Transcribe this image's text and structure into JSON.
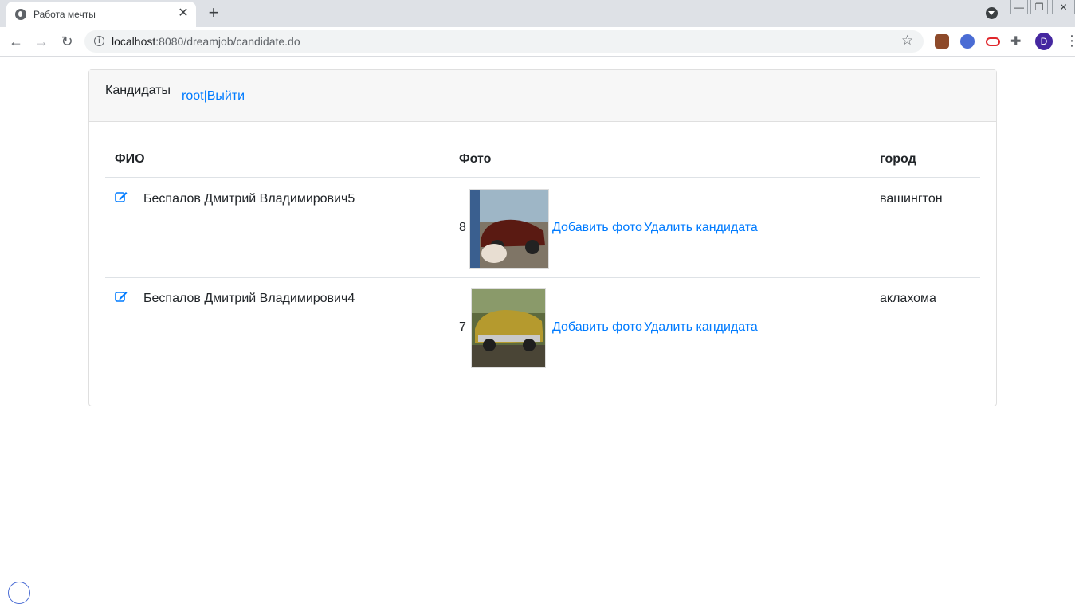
{
  "browser": {
    "tab_title": "Работа мечты",
    "tab_close": "✕",
    "new_tab": "+",
    "url_host": "localhost",
    "url_path": ":8080/dreamjob/candidate.do",
    "avatar_letter": "D",
    "win_min": "—",
    "win_max": "❐",
    "win_close": "✕"
  },
  "header": {
    "title": "Кандидаты",
    "user": "root",
    "separator": "|",
    "logout": "Выйти"
  },
  "table": {
    "columns": [
      "ФИО",
      "Фото",
      "город"
    ],
    "rows": [
      {
        "name": "Беспалов Дмитрий Владимирович5",
        "id": "8",
        "add_photo": "Добавить фото",
        "delete": "Удалить кандидата",
        "city": "вашингтон"
      },
      {
        "name": "Беспалов Дмитрий Владимирович4",
        "id": "7",
        "add_photo": "Добавить фото",
        "delete": "Удалить кандидата",
        "city": "аклахома"
      }
    ]
  },
  "colors": {
    "link": "#007bff",
    "header_bg": "#f7f7f7"
  }
}
